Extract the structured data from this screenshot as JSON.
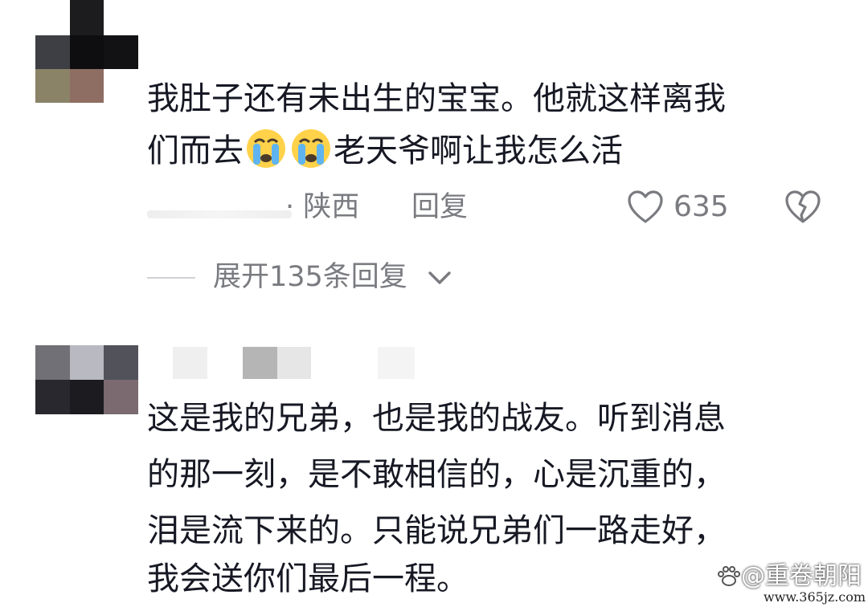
{
  "comments": [
    {
      "lines": [
        "我肚子还有未出生的宝宝。他就这样离我",
        "们而去",
        "老天爷啊让我怎么活"
      ],
      "emojis": [
        "crying-face-icon",
        "crying-face-icon"
      ],
      "location": "· 陕西",
      "reply_label": "回复",
      "like_count": "635",
      "expand_label": "展开135条回复"
    },
    {
      "lines": [
        "这是我的兄弟，也是我的战友。听到消息",
        "的那一刻，是不敢相信的，心是沉重的，",
        "泪是流下来的。只能说兄弟们一路走好，",
        "我会送你们最后一程。"
      ]
    }
  ],
  "watermark": {
    "brand": "@重卷朝阳",
    "url": "www.365jz.com"
  },
  "colors": {
    "text": "#161823",
    "meta": "#7a7b80",
    "emoji_face": "#ffd24a",
    "emoji_tear": "#5fb4f0"
  }
}
